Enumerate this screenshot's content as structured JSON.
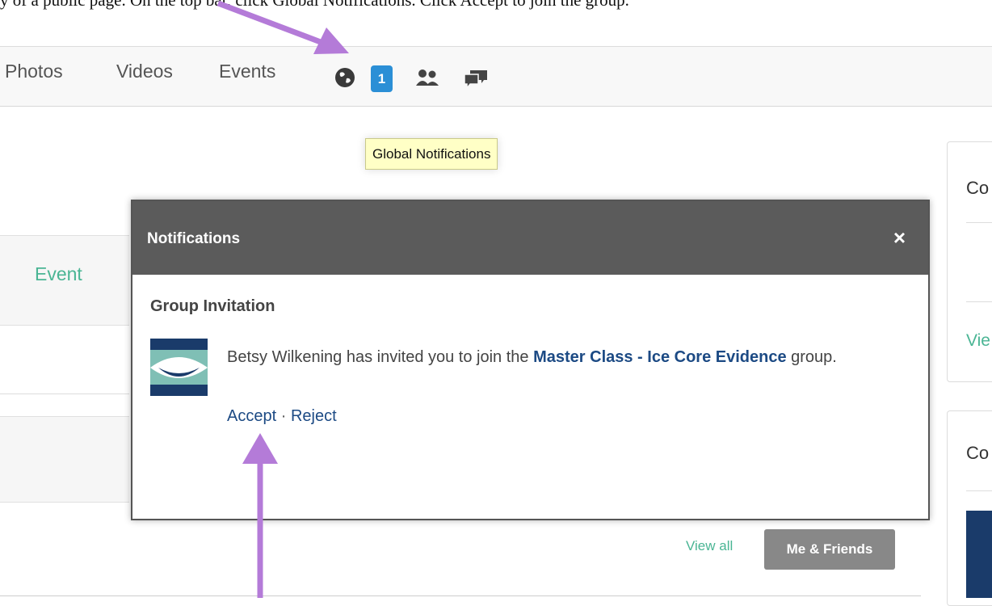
{
  "caption": {
    "text": "y of a public page. On the top bar, click Global Notifications. Click Accept to join the group."
  },
  "nav": {
    "items": [
      "Photos",
      "Videos",
      "Events"
    ],
    "icons": [
      "globe-icon",
      "notification-badge",
      "friends-icon",
      "chat-icon"
    ],
    "badge_count": "1"
  },
  "tooltip": {
    "text": "Global Notifications"
  },
  "left": {
    "event_tab": "Event"
  },
  "right": {
    "card1_title": "Co",
    "card1_link": "Vie",
    "card2_title": "Co"
  },
  "modal": {
    "title": "Notifications",
    "close_label": "×",
    "section_title": "Group Invitation",
    "invite_prefix": "Betsy Wilkening has invited you to join the ",
    "group_name": "Master Class - Ice Core Evidence",
    "invite_suffix": " group.",
    "accept_label": "Accept",
    "separator": " · ",
    "reject_label": "Reject"
  },
  "footer": {
    "view_all": "View all",
    "me_friends": "Me & Friends"
  },
  "colors": {
    "accent_green": "#4ab594",
    "badge_blue": "#2b8fd6",
    "modal_header": "#5b5b5b",
    "link_blue": "#1c4a84",
    "annotation_purple": "#b47bd8"
  }
}
